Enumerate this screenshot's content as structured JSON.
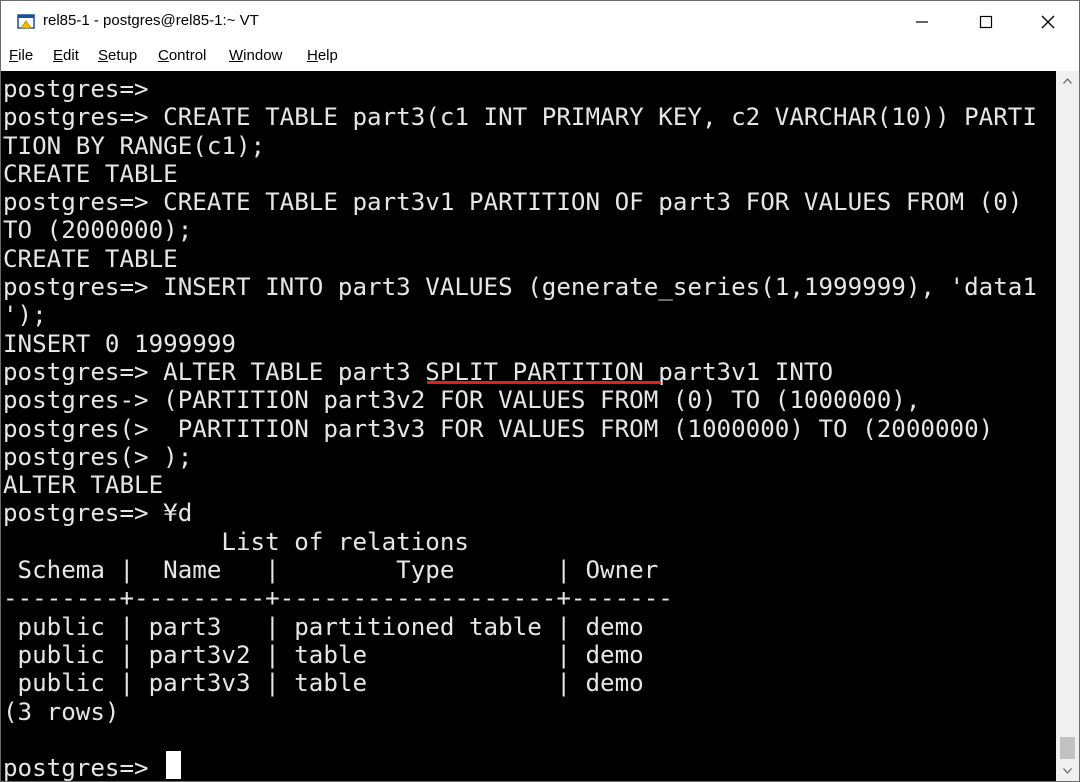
{
  "window": {
    "title": "rel85-1 - postgres@rel85-1:~ VT"
  },
  "menu": [
    {
      "key": "F",
      "rest": "ile"
    },
    {
      "key": "E",
      "rest": "dit"
    },
    {
      "key": "S",
      "rest": "etup"
    },
    {
      "key": "C",
      "rest": "ontrol"
    },
    {
      "key": "W",
      "rest": "indow"
    },
    {
      "key": "H",
      "rest": "elp"
    }
  ],
  "terminal": {
    "lines": [
      "postgres=>",
      "postgres=> CREATE TABLE part3(c1 INT PRIMARY KEY, c2 VARCHAR(10)) PARTI",
      "TION BY RANGE(c1);",
      "CREATE TABLE",
      "postgres=> CREATE TABLE part3v1 PARTITION OF part3 FOR VALUES FROM (0)",
      "TO (2000000);",
      "CREATE TABLE",
      "postgres=> INSERT INTO part3 VALUES (generate_series(1,1999999), 'data1",
      "');",
      "INSERT 0 1999999",
      "postgres=> ALTER TABLE part3 SPLIT PARTITION part3v1 INTO",
      "postgres-> (PARTITION part3v2 FOR VALUES FROM (0) TO (1000000),",
      "postgres(>  PARTITION part3v3 FOR VALUES FROM (1000000) TO (2000000)",
      "postgres(> );",
      "ALTER TABLE",
      "postgres=> ¥d",
      "               List of relations",
      " Schema |  Name   |        Type       | Owner",
      "--------+---------+-------------------+-------",
      " public | part3   | partitioned table | demo",
      " public | part3v2 | table             | demo",
      " public | part3v3 | table             | demo",
      "(3 rows)",
      "",
      "postgres=>"
    ]
  },
  "colors": {
    "terminal_bg": "#000000",
    "terminal_fg": "#e6e6e6",
    "highlight_underline": "#e0201c"
  }
}
